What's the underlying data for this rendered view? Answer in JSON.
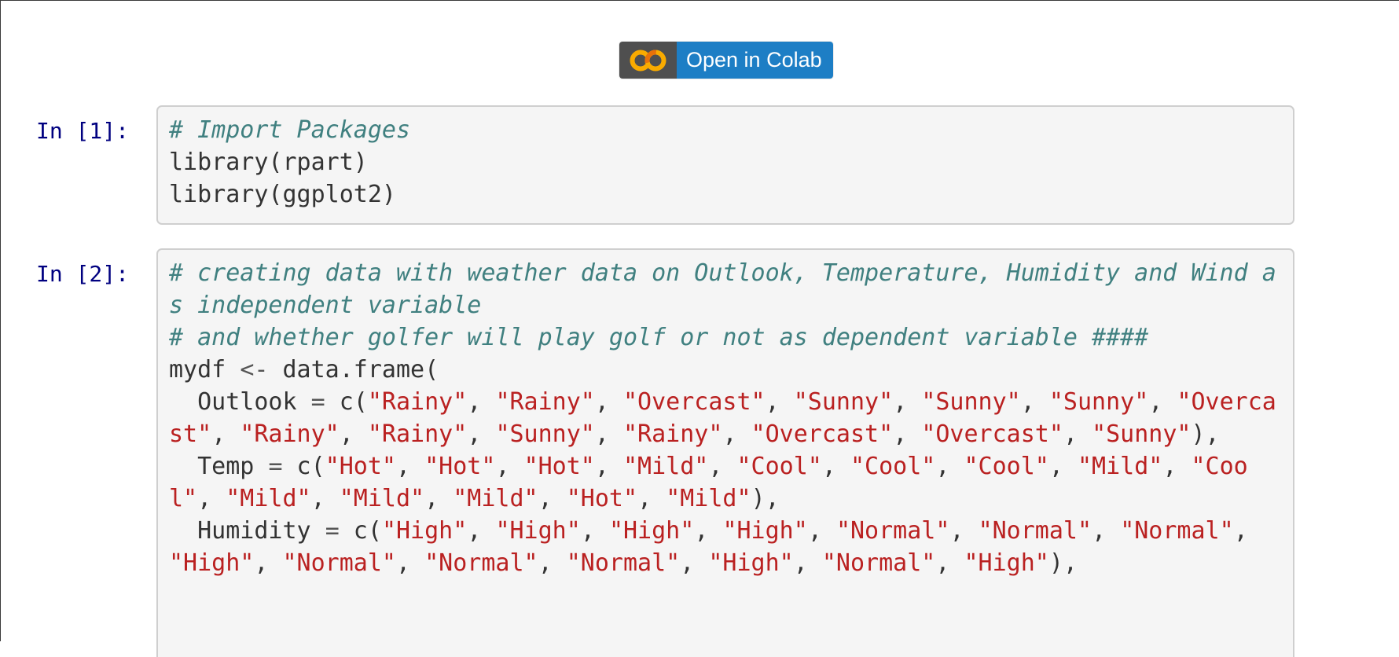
{
  "colab_badge": {
    "label": "Open in Colab",
    "logo_text": "CO"
  },
  "cells": [
    {
      "prompt": "In [1]:",
      "lines": [
        [
          {
            "t": "c",
            "v": "# Import Packages"
          }
        ],
        [
          {
            "t": "n",
            "v": "library(rpart)"
          }
        ],
        [
          {
            "t": "n",
            "v": "library(ggplot2)"
          }
        ]
      ]
    },
    {
      "prompt": "In [2]:",
      "lines": [
        [
          {
            "t": "c",
            "v": "# creating data with weather data on Outlook, Temperature, Humidity and Wind as independent variable"
          }
        ],
        [
          {
            "t": "c",
            "v": "# and whether golfer will play golf or not as dependent variable ####"
          }
        ],
        [
          {
            "t": "n",
            "v": "mydf "
          },
          {
            "t": "o",
            "v": "<-"
          },
          {
            "t": "n",
            "v": " data.frame("
          }
        ],
        [
          {
            "t": "n",
            "v": "  Outlook "
          },
          {
            "t": "o",
            "v": "="
          },
          {
            "t": "n",
            "v": " c("
          },
          {
            "t": "s",
            "v": "\"Rainy\""
          },
          {
            "t": "n",
            "v": ", "
          },
          {
            "t": "s",
            "v": "\"Rainy\""
          },
          {
            "t": "n",
            "v": ", "
          },
          {
            "t": "s",
            "v": "\"Overcast\""
          },
          {
            "t": "n",
            "v": ", "
          },
          {
            "t": "s",
            "v": "\"Sunny\""
          },
          {
            "t": "n",
            "v": ", "
          },
          {
            "t": "s",
            "v": "\"Sunny\""
          },
          {
            "t": "n",
            "v": ", "
          },
          {
            "t": "s",
            "v": "\"Sunny\""
          },
          {
            "t": "n",
            "v": ", "
          },
          {
            "t": "s",
            "v": "\"Overcast\""
          },
          {
            "t": "n",
            "v": ", "
          },
          {
            "t": "s",
            "v": "\"Rainy\""
          },
          {
            "t": "n",
            "v": ", "
          },
          {
            "t": "s",
            "v": "\"Rainy\""
          },
          {
            "t": "n",
            "v": ", "
          },
          {
            "t": "s",
            "v": "\"Sunny\""
          },
          {
            "t": "n",
            "v": ", "
          },
          {
            "t": "s",
            "v": "\"Rainy\""
          },
          {
            "t": "n",
            "v": ", "
          },
          {
            "t": "s",
            "v": "\"Overcast\""
          },
          {
            "t": "n",
            "v": ", "
          },
          {
            "t": "s",
            "v": "\"Overcast\""
          },
          {
            "t": "n",
            "v": ", "
          },
          {
            "t": "s",
            "v": "\"Sunny\""
          },
          {
            "t": "n",
            "v": "),"
          }
        ],
        [
          {
            "t": "n",
            "v": "  Temp "
          },
          {
            "t": "o",
            "v": "="
          },
          {
            "t": "n",
            "v": " c("
          },
          {
            "t": "s",
            "v": "\"Hot\""
          },
          {
            "t": "n",
            "v": ", "
          },
          {
            "t": "s",
            "v": "\"Hot\""
          },
          {
            "t": "n",
            "v": ", "
          },
          {
            "t": "s",
            "v": "\"Hot\""
          },
          {
            "t": "n",
            "v": ", "
          },
          {
            "t": "s",
            "v": "\"Mild\""
          },
          {
            "t": "n",
            "v": ", "
          },
          {
            "t": "s",
            "v": "\"Cool\""
          },
          {
            "t": "n",
            "v": ", "
          },
          {
            "t": "s",
            "v": "\"Cool\""
          },
          {
            "t": "n",
            "v": ", "
          },
          {
            "t": "s",
            "v": "\"Cool\""
          },
          {
            "t": "n",
            "v": ", "
          },
          {
            "t": "s",
            "v": "\"Mild\""
          },
          {
            "t": "n",
            "v": ", "
          },
          {
            "t": "s",
            "v": "\"Cool\""
          },
          {
            "t": "n",
            "v": ", "
          },
          {
            "t": "s",
            "v": "\"Mild\""
          },
          {
            "t": "n",
            "v": ", "
          },
          {
            "t": "s",
            "v": "\"Mild\""
          },
          {
            "t": "n",
            "v": ", "
          },
          {
            "t": "s",
            "v": "\"Mild\""
          },
          {
            "t": "n",
            "v": ", "
          },
          {
            "t": "s",
            "v": "\"Hot\""
          },
          {
            "t": "n",
            "v": ", "
          },
          {
            "t": "s",
            "v": "\"Mild\""
          },
          {
            "t": "n",
            "v": "),"
          }
        ],
        [
          {
            "t": "n",
            "v": "  Humidity "
          },
          {
            "t": "o",
            "v": "="
          },
          {
            "t": "n",
            "v": " c("
          },
          {
            "t": "s",
            "v": "\"High\""
          },
          {
            "t": "n",
            "v": ", "
          },
          {
            "t": "s",
            "v": "\"High\""
          },
          {
            "t": "n",
            "v": ", "
          },
          {
            "t": "s",
            "v": "\"High\""
          },
          {
            "t": "n",
            "v": ", "
          },
          {
            "t": "s",
            "v": "\"High\""
          },
          {
            "t": "n",
            "v": ", "
          },
          {
            "t": "s",
            "v": "\"Normal\""
          },
          {
            "t": "n",
            "v": ", "
          },
          {
            "t": "s",
            "v": "\"Normal\""
          },
          {
            "t": "n",
            "v": ", "
          },
          {
            "t": "s",
            "v": "\"Normal\""
          },
          {
            "t": "n",
            "v": ", "
          },
          {
            "t": "s",
            "v": "\"High\""
          },
          {
            "t": "n",
            "v": ", "
          },
          {
            "t": "s",
            "v": "\"Normal\""
          },
          {
            "t": "n",
            "v": ", "
          },
          {
            "t": "s",
            "v": "\"Normal\""
          },
          {
            "t": "n",
            "v": ", "
          },
          {
            "t": "s",
            "v": "\"Normal\""
          },
          {
            "t": "n",
            "v": ", "
          },
          {
            "t": "s",
            "v": "\"High\""
          },
          {
            "t": "n",
            "v": ", "
          },
          {
            "t": "s",
            "v": "\"Normal\""
          },
          {
            "t": "n",
            "v": ", "
          },
          {
            "t": "s",
            "v": "\"High\""
          },
          {
            "t": "n",
            "v": "),"
          }
        ]
      ]
    }
  ],
  "colors": {
    "prompt": "#000080",
    "comment": "#408080",
    "string": "#ba2121",
    "code": "#333333",
    "colab_blue": "#1d7ec5",
    "colab_logo_bg": "#4f4f4f",
    "colab_logo_orange": "#f9ab00"
  }
}
